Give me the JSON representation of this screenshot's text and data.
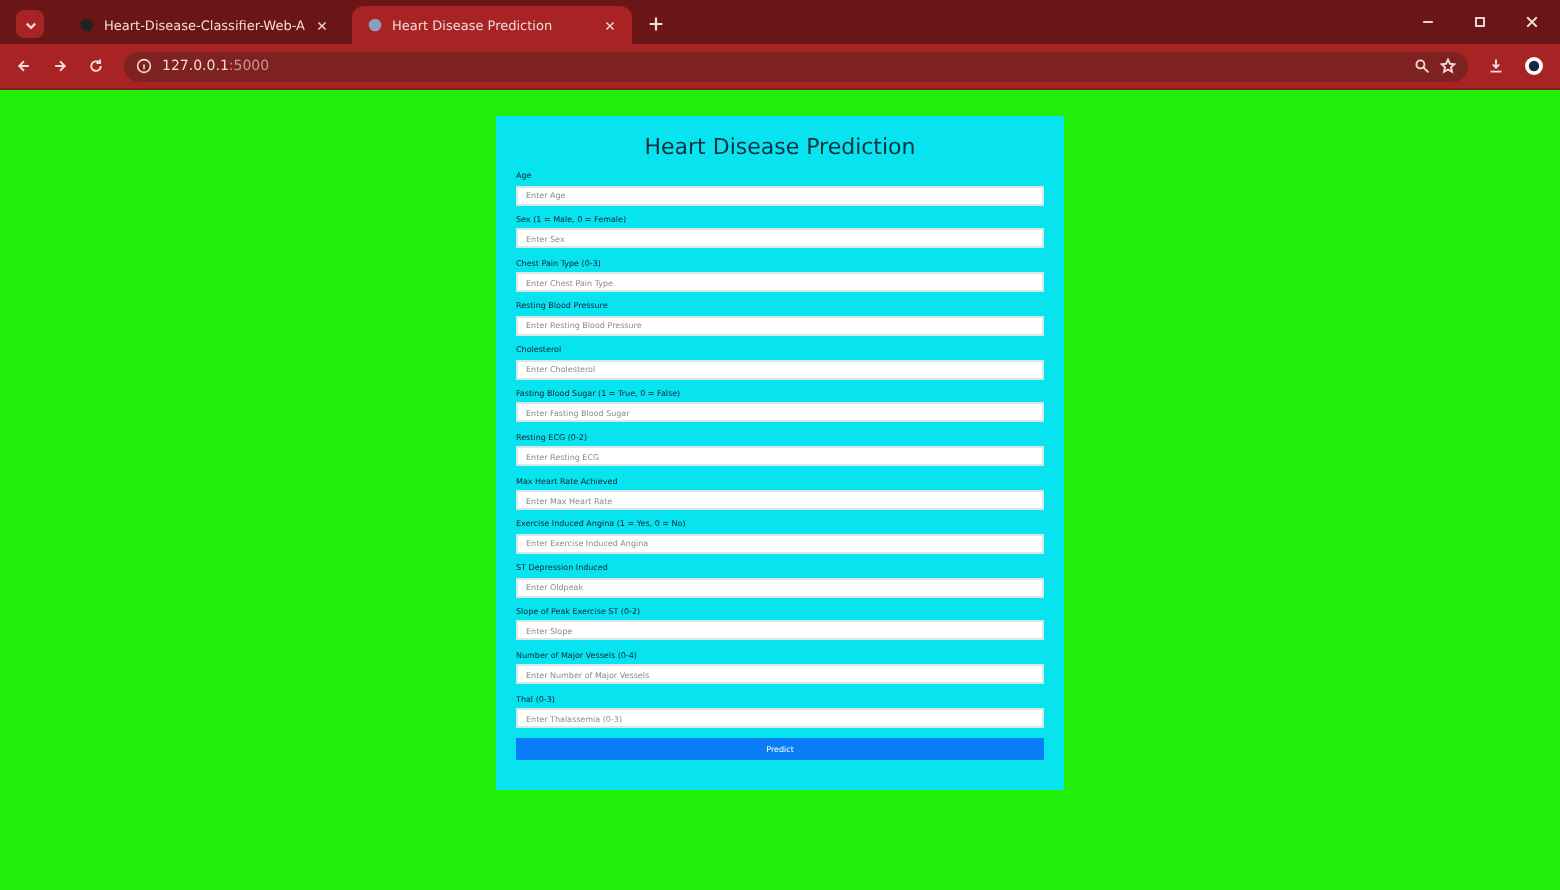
{
  "browser": {
    "tabs": [
      {
        "title": "Heart-Disease-Classifier-Web-A",
        "selected": false
      },
      {
        "title": "Heart Disease Prediction",
        "selected": true
      }
    ],
    "url_host": "127.0.0.1",
    "url_port": ":5000"
  },
  "form": {
    "title": "Heart Disease Prediction",
    "fields": [
      {
        "label": "Age",
        "placeholder": "Enter Age"
      },
      {
        "label": "Sex (1 = Male, 0 = Female)",
        "placeholder": "Enter Sex"
      },
      {
        "label": "Chest Pain Type (0-3)",
        "placeholder": "Enter Chest Pain Type"
      },
      {
        "label": "Resting Blood Pressure",
        "placeholder": "Enter Resting Blood Pressure"
      },
      {
        "label": "Cholesterol",
        "placeholder": "Enter Cholesterol"
      },
      {
        "label": "Fasting Blood Sugar (1 = True, 0 = False)",
        "placeholder": "Enter Fasting Blood Sugar"
      },
      {
        "label": "Resting ECG (0-2)",
        "placeholder": "Enter Resting ECG"
      },
      {
        "label": "Max Heart Rate Achieved",
        "placeholder": "Enter Max Heart Rate"
      },
      {
        "label": "Exercise Induced Angina (1 = Yes, 0 = No)",
        "placeholder": "Enter Exercise Induced Angina"
      },
      {
        "label": "ST Depression Induced",
        "placeholder": "Enter Oldpeak"
      },
      {
        "label": "Slope of Peak Exercise ST (0-2)",
        "placeholder": "Enter Slope"
      },
      {
        "label": "Number of Major Vessels (0-4)",
        "placeholder": "Enter Number of Major Vessels"
      },
      {
        "label": "Thal (0-3)",
        "placeholder": "Enter Thalassemia (0-3)"
      }
    ],
    "button": "Predict"
  }
}
